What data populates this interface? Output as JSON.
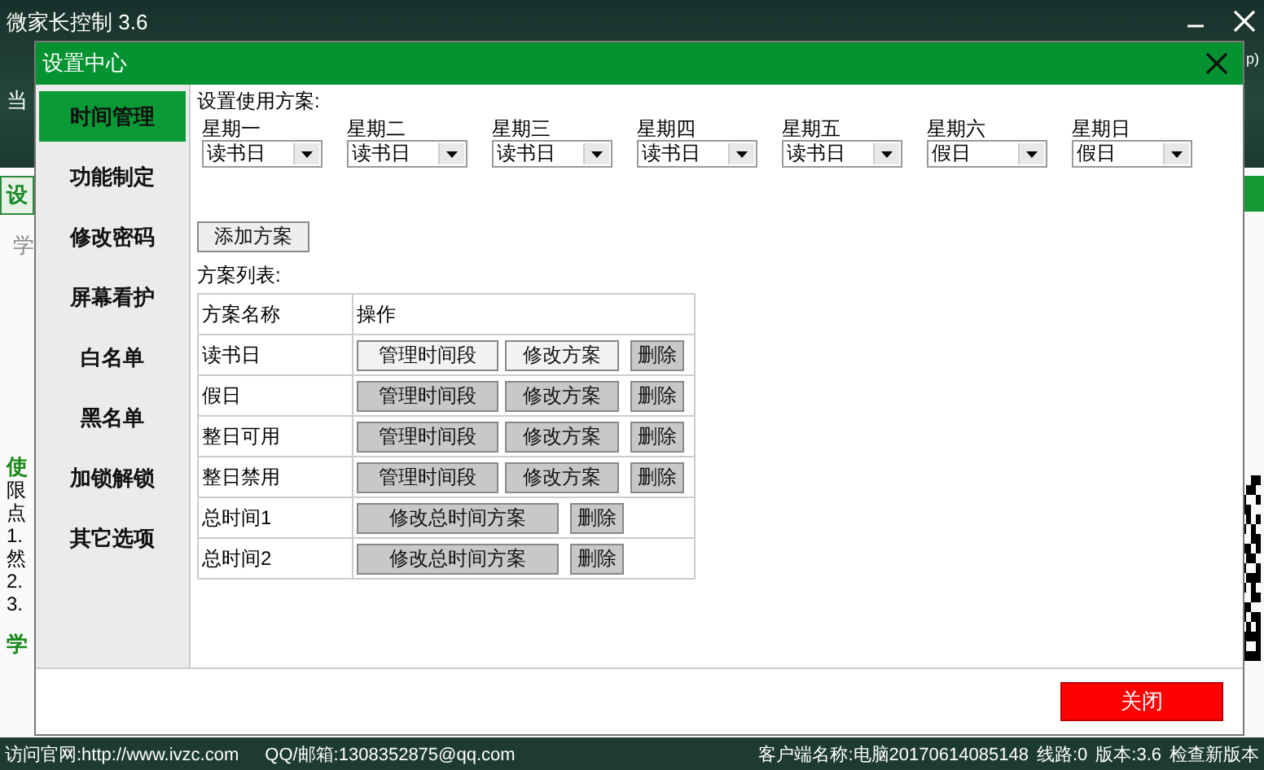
{
  "app": {
    "title": "微家长控制 3.6",
    "top_right_fragment": "p)",
    "left_fragments": [
      {
        "text": "当",
        "kind": "dark"
      },
      {
        "text": "设",
        "kind": "button"
      },
      {
        "text": "学",
        "kind": "muted"
      },
      {
        "text": "使",
        "kind": "green"
      },
      {
        "text": "限",
        "kind": "plain"
      },
      {
        "text": "点",
        "kind": "plain"
      },
      {
        "text": "1.",
        "kind": "plain"
      },
      {
        "text": "然",
        "kind": "plain"
      },
      {
        "text": "2.",
        "kind": "plain"
      },
      {
        "text": "3.",
        "kind": "plain"
      },
      {
        "text": "学",
        "kind": "green"
      }
    ]
  },
  "dialog": {
    "title": "设置中心",
    "sidebar": [
      {
        "label": "时间管理",
        "selected": true
      },
      {
        "label": "功能制定",
        "selected": false
      },
      {
        "label": "修改密码",
        "selected": false
      },
      {
        "label": "屏幕看护",
        "selected": false
      },
      {
        "label": "白名单",
        "selected": false
      },
      {
        "label": "黑名单",
        "selected": false
      },
      {
        "label": "加锁解锁",
        "selected": false
      },
      {
        "label": "其它选项",
        "selected": false
      }
    ],
    "plan_label": "设置使用方案:",
    "days": [
      {
        "day": "星期一",
        "value": "读书日"
      },
      {
        "day": "星期二",
        "value": "读书日"
      },
      {
        "day": "星期三",
        "value": "读书日"
      },
      {
        "day": "星期四",
        "value": "读书日"
      },
      {
        "day": "星期五",
        "value": "读书日"
      },
      {
        "day": "星期六",
        "value": "假日"
      },
      {
        "day": "星期日",
        "value": "假日"
      }
    ],
    "add_button": "添加方案",
    "list_label": "方案列表:",
    "table": {
      "columns": [
        "方案名称",
        "操作"
      ],
      "rows": [
        {
          "name": "读书日",
          "actions": [
            {
              "label": "管理时间段",
              "highlighted": true
            },
            {
              "label": "修改方案",
              "highlighted": true
            },
            {
              "label": "删除",
              "highlighted": false
            }
          ]
        },
        {
          "name": "假日",
          "actions": [
            {
              "label": "管理时间段",
              "highlighted": false
            },
            {
              "label": "修改方案",
              "highlighted": false
            },
            {
              "label": "删除",
              "highlighted": false
            }
          ]
        },
        {
          "name": "整日可用",
          "actions": [
            {
              "label": "管理时间段",
              "highlighted": false
            },
            {
              "label": "修改方案",
              "highlighted": false
            },
            {
              "label": "删除",
              "highlighted": false
            }
          ]
        },
        {
          "name": "整日禁用",
          "actions": [
            {
              "label": "管理时间段",
              "highlighted": false
            },
            {
              "label": "修改方案",
              "highlighted": false
            },
            {
              "label": "删除",
              "highlighted": false
            }
          ]
        },
        {
          "name": "总时间1",
          "actions": [
            {
              "label": "修改总时间方案",
              "highlighted": false
            },
            {
              "label": "删除",
              "highlighted": false
            }
          ]
        },
        {
          "name": "总时间2",
          "actions": [
            {
              "label": "修改总时间方案",
              "highlighted": false
            },
            {
              "label": "删除",
              "highlighted": false
            }
          ]
        }
      ]
    },
    "close_button": "关闭"
  },
  "status_bar": {
    "website": "访问官网:http://www.ivzc.com",
    "contact": "QQ/邮箱:1308352875@qq.com",
    "client": "客户端名称:电脑20170614085148",
    "line": "线路:0",
    "version": "版本:3.6",
    "update_link": "检查新版本"
  }
}
